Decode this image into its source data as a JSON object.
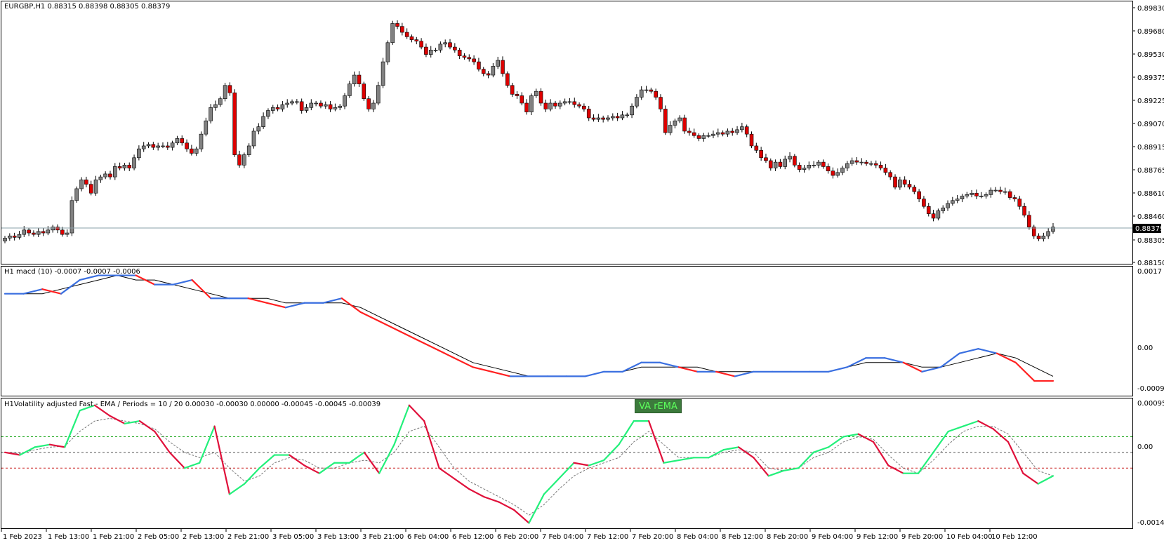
{
  "main_panel": {
    "title": "EURGBP,H1  0.88315 0.88398 0.88305 0.88379",
    "price_levels": [
      "0.89830",
      "0.89680",
      "0.89530",
      "0.89375",
      "0.89225",
      "0.89070",
      "0.88915",
      "0.88765",
      "0.88610",
      "0.88460",
      "0.88305",
      "0.88150"
    ],
    "current_price": "0.88379"
  },
  "macd_panel": {
    "title": "H1  macd (10) -0.0007 -0.0007 -0.0006",
    "levels": [
      "0.0017",
      "0.00",
      "-0.0009"
    ]
  },
  "vol_panel": {
    "title": "H1Volatility adjusted Fast - EMA / Periods = 10 / 20  0.00030 -0.00030 0.00000 -0.00045 -0.00045 -0.00039",
    "levels": [
      "0.00095",
      "0.00",
      "-0.00141"
    ],
    "button_label": "VA rEMA"
  },
  "time_axis": [
    "1 Feb 2023",
    "1 Feb 13:00",
    "1 Feb 21:00",
    "2 Feb 05:00",
    "2 Feb 13:00",
    "2 Feb 21:00",
    "3 Feb 05:00",
    "3 Feb 13:00",
    "3 Feb 21:00",
    "6 Feb 04:00",
    "6 Feb 12:00",
    "6 Feb 20:00",
    "7 Feb 04:00",
    "7 Feb 12:00",
    "7 Feb 20:00",
    "8 Feb 04:00",
    "8 Feb 12:00",
    "8 Feb 20:00",
    "9 Feb 04:00",
    "9 Feb 12:00",
    "9 Feb 20:00",
    "10 Feb 04:00",
    "10 Feb 12:00"
  ],
  "colors": {
    "bull": "#808080",
    "bear": "#dd0000",
    "macd_up": "#3a6fe0",
    "macd_down": "#ff2020",
    "vol_up": "#22f07a",
    "vol_down": "#e0103a",
    "green_level": "#22aa22",
    "red_level": "#cc2222"
  },
  "chart_data": [
    {
      "type": "candlestick",
      "symbol": "EURGBP",
      "timeframe": "H1",
      "close_series": [
        0.88305,
        0.8832,
        0.8831,
        0.8833,
        0.8836,
        0.8834,
        0.8833,
        0.8835,
        0.8834,
        0.8836,
        0.8838,
        0.8836,
        0.8833,
        0.8834,
        0.8856,
        0.8864,
        0.887,
        0.8867,
        0.8861,
        0.887,
        0.8872,
        0.8874,
        0.8872,
        0.8879,
        0.8878,
        0.888,
        0.8878,
        0.8885,
        0.8891,
        0.8893,
        0.8894,
        0.8892,
        0.8893,
        0.8893,
        0.8892,
        0.8895,
        0.8898,
        0.8895,
        0.8891,
        0.8888,
        0.8891,
        0.8901,
        0.891,
        0.8919,
        0.8921,
        0.8925,
        0.8934,
        0.8929,
        0.8887,
        0.888,
        0.8887,
        0.8893,
        0.8903,
        0.8906,
        0.8913,
        0.8917,
        0.8919,
        0.8918,
        0.8921,
        0.8922,
        0.8923,
        0.8923,
        0.8917,
        0.8919,
        0.8922,
        0.8922,
        0.892,
        0.8921,
        0.8918,
        0.8919,
        0.892,
        0.8927,
        0.8935,
        0.8941,
        0.8935,
        0.8925,
        0.8918,
        0.8922,
        0.8934,
        0.895,
        0.8963,
        0.8976,
        0.8974,
        0.897,
        0.8967,
        0.8965,
        0.8964,
        0.896,
        0.8955,
        0.8958,
        0.8958,
        0.8962,
        0.8963,
        0.896,
        0.8958,
        0.8954,
        0.8953,
        0.8952,
        0.895,
        0.8945,
        0.8942,
        0.8941,
        0.8947,
        0.8951,
        0.8942,
        0.8934,
        0.8928,
        0.8927,
        0.8922,
        0.8916,
        0.8927,
        0.893,
        0.8922,
        0.8918,
        0.8922,
        0.892,
        0.8922,
        0.8923,
        0.8923,
        0.8921,
        0.892,
        0.8918,
        0.8912,
        0.8911,
        0.8912,
        0.8911,
        0.8912,
        0.8913,
        0.8912,
        0.8914,
        0.8914,
        0.892,
        0.8926,
        0.8931,
        0.8931,
        0.893,
        0.8926,
        0.8918,
        0.8902,
        0.8907,
        0.891,
        0.8912,
        0.8903,
        0.8902,
        0.89,
        0.8898,
        0.89,
        0.89,
        0.8901,
        0.8902,
        0.8901,
        0.8903,
        0.8902,
        0.8904,
        0.8906,
        0.8901,
        0.8893,
        0.889,
        0.8885,
        0.8883,
        0.8878,
        0.8882,
        0.8879,
        0.8884,
        0.8886,
        0.888,
        0.8877,
        0.8878,
        0.888,
        0.888,
        0.8882,
        0.8879,
        0.8876,
        0.8873,
        0.8875,
        0.8878,
        0.8881,
        0.8883,
        0.8882,
        0.8882,
        0.8881,
        0.8881,
        0.888,
        0.8878,
        0.8875,
        0.8872,
        0.8865,
        0.887,
        0.8867,
        0.8865,
        0.8862,
        0.8857,
        0.8852,
        0.8847,
        0.8844,
        0.8849,
        0.8851,
        0.8854,
        0.8856,
        0.8857,
        0.8859,
        0.886,
        0.8861,
        0.8859,
        0.8859,
        0.886,
        0.8863,
        0.8863,
        0.8862,
        0.8862,
        0.8858,
        0.8857,
        0.8852,
        0.8846,
        0.8838,
        0.8832,
        0.883,
        0.8832,
        0.8835,
        0.8838
      ],
      "ylim": [
        0.8815,
        0.899
      ],
      "current": 0.88379
    },
    {
      "type": "line",
      "title": "H1  macd (10) -0.0007 -0.0007 -0.0006",
      "ylim": [
        -0.0009,
        0.0017
      ],
      "series": [
        {
          "values": [
            0.0012,
            0.0012,
            0.0013,
            0.0012,
            0.0015,
            0.0016,
            0.0016,
            0.0016,
            0.0014,
            0.0014,
            0.0015,
            0.0011,
            0.0011,
            0.0011,
            0.001,
            0.0009,
            0.001,
            0.001,
            0.0011,
            0.0008,
            0.0006,
            0.0004,
            0.0002,
            0.0,
            -0.0002,
            -0.0004,
            -0.0005,
            -0.0006,
            -0.0006,
            -0.0006,
            -0.0006,
            -0.0006,
            -0.0005,
            -0.0005,
            -0.0003,
            -0.0003,
            -0.0004,
            -0.0005,
            -0.0005,
            -0.0006,
            -0.0005,
            -0.0005,
            -0.0005,
            -0.0005,
            -0.0005,
            -0.0004,
            -0.0002,
            -0.0002,
            -0.0003,
            -0.0005,
            -0.0004,
            -0.0001,
            0.0,
            -0.0001,
            -0.0003,
            -0.0007,
            -0.0007
          ]
        },
        {
          "values": [
            0.0012,
            0.0012,
            0.0012,
            0.0013,
            0.0014,
            0.0015,
            0.0016,
            0.0015,
            0.0015,
            0.0014,
            0.0013,
            0.0012,
            0.0011,
            0.0011,
            0.0011,
            0.001,
            0.001,
            0.001,
            0.001,
            0.0009,
            0.0007,
            0.0005,
            0.0003,
            0.0001,
            -0.0001,
            -0.0003,
            -0.0004,
            -0.0005,
            -0.0006,
            -0.0006,
            -0.0006,
            -0.0006,
            -0.0005,
            -0.0005,
            -0.0004,
            -0.0004,
            -0.0004,
            -0.0004,
            -0.0005,
            -0.0005,
            -0.0005,
            -0.0005,
            -0.0005,
            -0.0005,
            -0.0005,
            -0.0004,
            -0.0003,
            -0.0003,
            -0.0003,
            -0.0004,
            -0.0004,
            -0.0003,
            -0.0002,
            -0.0001,
            -0.0002,
            -0.0004,
            -0.0006
          ]
        }
      ]
    },
    {
      "type": "line",
      "title": "H1Volatility adjusted Fast - EMA / Periods = 10 / 20  0.00030 -0.00030 0.00000 -0.00045 -0.00045 -0.00039",
      "ylim": [
        -0.00141,
        0.00095
      ],
      "levels": [
        0.0003,
        0.0,
        -0.0003
      ],
      "series": [
        {
          "values": [
            0.0,
            -5e-05,
            0.0001,
            0.00015,
            0.0001,
            0.0008,
            0.0009,
            0.0007,
            0.00055,
            0.0006,
            0.0004,
            0.0,
            -0.0003,
            -0.0002,
            0.0005,
            -0.0008,
            -0.0006,
            -0.0003,
            -5e-05,
            -5e-05,
            -0.00025,
            -0.0004,
            -0.0002,
            -0.0002,
            0.0,
            -0.0004,
            0.00015,
            0.0009,
            0.0006,
            -0.0003,
            -0.0005,
            -0.0007,
            -0.00085,
            -0.00095,
            -0.0011,
            -0.00135,
            -0.0008,
            -0.0005,
            -0.0002,
            -0.00025,
            -0.00015,
            0.00015,
            0.0006,
            0.0006,
            -0.0002,
            -0.00015,
            -0.0001,
            -0.0001,
            5e-05,
            0.0001,
            -0.0001,
            -0.00045,
            -0.00035,
            -0.0003,
            0.0,
            0.0001,
            0.0003,
            0.00035,
            0.0002,
            -0.00025,
            -0.0004,
            -0.0004,
            0.0,
            0.0004,
            0.0005,
            0.0006,
            0.00045,
            0.0002,
            -0.0004,
            -0.0006,
            -0.00045
          ]
        },
        {
          "values": [
            0.0,
            -2e-05,
            5e-05,
            0.0001,
            0.00012,
            0.0004,
            0.0006,
            0.00065,
            0.0006,
            0.00055,
            0.00045,
            0.0002,
            0.0,
            -0.0001,
            0.0,
            -0.0003,
            -0.00055,
            -0.00045,
            -0.0002,
            -0.0001,
            -0.00015,
            -0.0003,
            -0.0003,
            -0.0002,
            -0.00015,
            -0.0002,
            0.0,
            0.0004,
            0.0005,
            0.0001,
            -0.0003,
            -0.00055,
            -0.0007,
            -0.00085,
            -0.001,
            -0.0012,
            -0.001,
            -0.0007,
            -0.00045,
            -0.0003,
            -0.0002,
            -0.0001,
            0.0002,
            0.0004,
            0.00015,
            -0.0001,
            -0.0001,
            -0.0001,
            0.0,
            5e-05,
            0.0,
            -0.0003,
            -0.00035,
            -0.0003,
            -0.0001,
            0.0,
            0.0002,
            0.0003,
            0.00025,
            -5e-05,
            -0.0003,
            -0.0004,
            -0.00015,
            0.00015,
            0.0004,
            0.0005,
            0.0005,
            0.00035,
            0.0,
            -0.00035,
            -0.00045
          ]
        }
      ]
    }
  ]
}
